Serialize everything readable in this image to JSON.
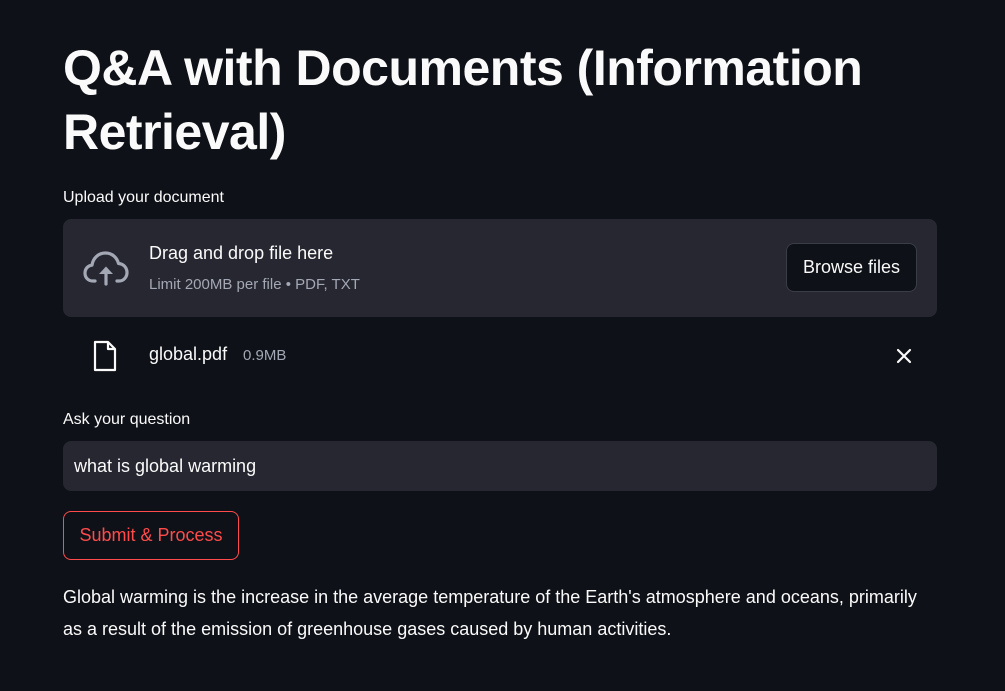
{
  "page": {
    "title": "Q&A with Documents (Information Retrieval)"
  },
  "uploader": {
    "label": "Upload your document",
    "drop_title": "Drag and drop file here",
    "drop_limit": "Limit 200MB per file • PDF, TXT",
    "browse_label": "Browse files",
    "icon": "cloud-upload-icon"
  },
  "uploaded_file": {
    "name": "global.pdf",
    "size": "0.9MB",
    "icon": "file-icon",
    "remove_icon": "close-icon"
  },
  "question": {
    "label": "Ask your question",
    "value": "what is global warming"
  },
  "submit": {
    "label": "Submit & Process"
  },
  "answer": {
    "text": "Global warming is the increase in the average temperature of the Earth's atmosphere and oceans, primarily as a result of the emission of greenhouse gases caused by human activities."
  },
  "colors": {
    "background": "#0e1117",
    "surface": "#262730",
    "text": "#fafafa",
    "muted_text": "#a3a8b4",
    "accent": "#ff4b4b"
  }
}
